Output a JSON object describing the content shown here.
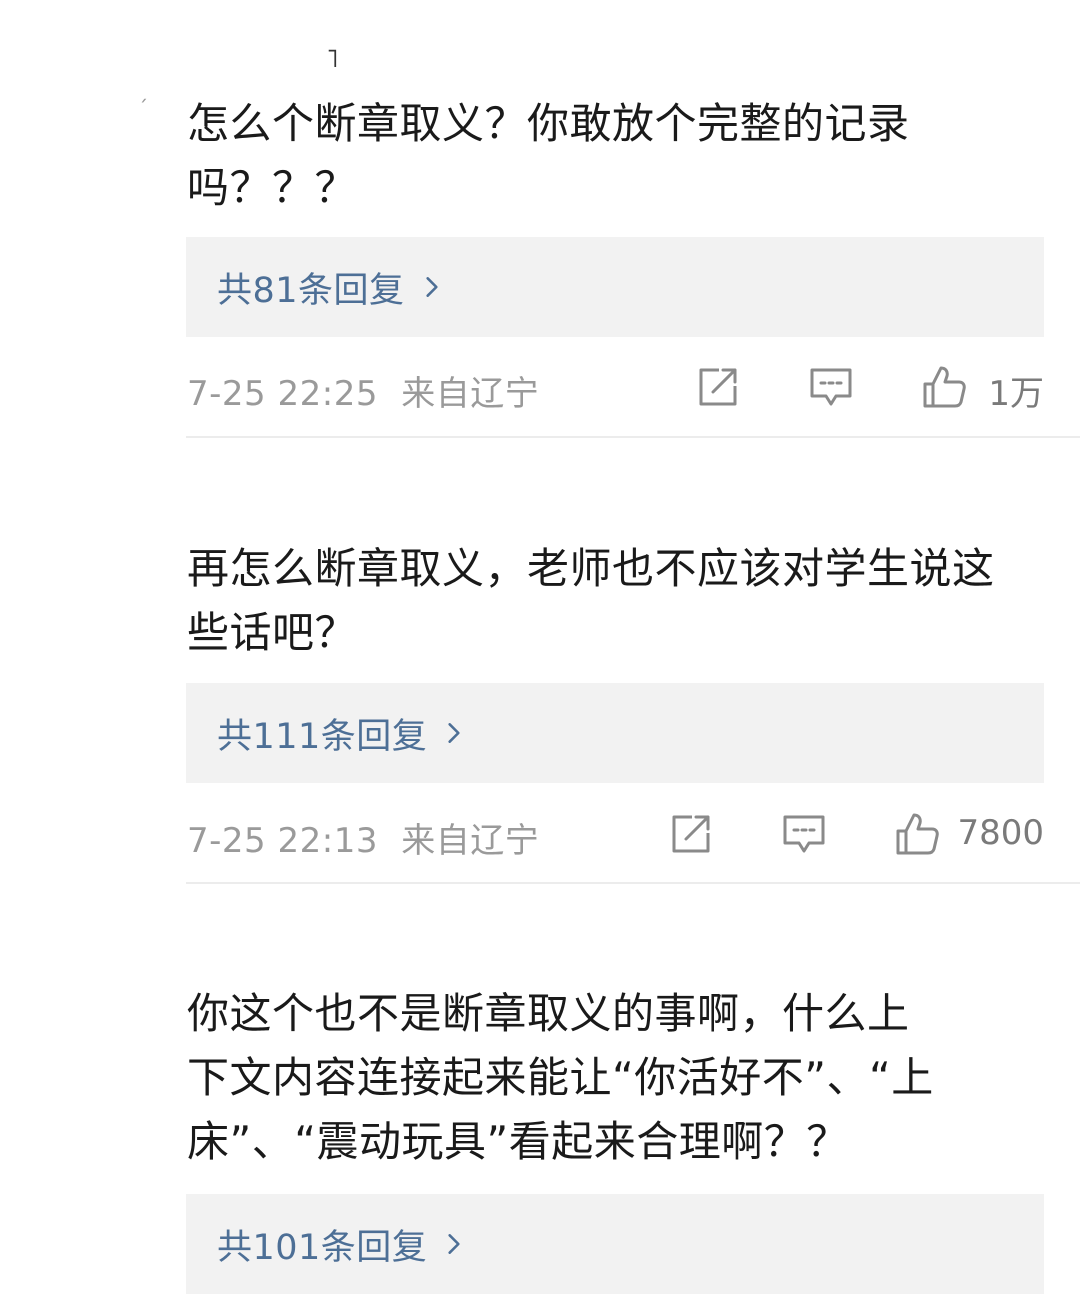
{
  "comments": [
    {
      "text": "怎么个断章取义？你敢放个完整的记录\n吗？？？",
      "reply_label": "共81条回复",
      "time": "7-25 22:25",
      "location": "来自辽宁",
      "likes": "1万",
      "icons": [
        "share-icon",
        "comment-icon",
        "like-icon"
      ]
    },
    {
      "text": "再怎么断章取义，老师也不应该对学生说这\n些话吧？",
      "reply_label": "共111条回复",
      "time": "7-25 22:13",
      "location": "来自辽宁",
      "likes": "7800",
      "icons": [
        "share-icon",
        "comment-icon",
        "like-icon"
      ]
    },
    {
      "text": "你这个也不是断章取义的事啊，什么上\n下文内容连接起来能让“你活好不”、“上\n床”、“震动玩具”看起来合理啊？？",
      "reply_label": "共101条回复",
      "icons": [
        "chevron-right-icon"
      ]
    }
  ],
  "colors": {
    "text": "#1a1a1a",
    "reply_link": "#4d6f96",
    "reply_bg": "#f2f2f2",
    "meta": "#9a9a9a",
    "icon": "#8a8a8a"
  }
}
